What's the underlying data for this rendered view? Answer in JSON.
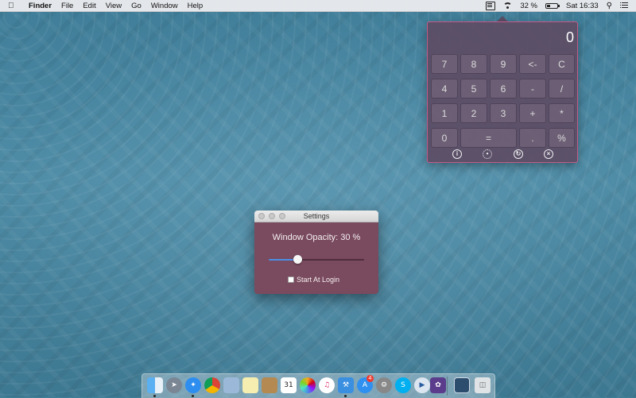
{
  "menubar": {
    "app_name": "Finder",
    "menus": [
      "File",
      "Edit",
      "View",
      "Go",
      "Window",
      "Help"
    ],
    "battery_percent": "32 %",
    "battery_level": 0.32,
    "clock": "Sat 16:33"
  },
  "calculator": {
    "display": "0",
    "keys": {
      "row1": [
        "7",
        "8",
        "9",
        "<-",
        "C"
      ],
      "row2": [
        "4",
        "5",
        "6",
        "-",
        "/"
      ],
      "row3": [
        "1",
        "2",
        "3",
        "+",
        "*"
      ],
      "row4": [
        "0",
        "=",
        ".",
        "%"
      ]
    },
    "toolbar_icons": [
      "info-icon",
      "gear-icon",
      "history-icon",
      "close-icon"
    ]
  },
  "settings": {
    "title": "Settings",
    "opacity_label": "Window Opacity: 30 %",
    "opacity_value": 0.3,
    "start_at_login_label": "Start At Login",
    "start_at_login_checked": false
  },
  "dock": {
    "icons": [
      "finder",
      "launchpad",
      "safari",
      "chrome",
      "preview",
      "notes",
      "contacts",
      "calendar",
      "photos",
      "itunes",
      "xcode",
      "app-store",
      "system-preferences",
      "skype",
      "quicktime",
      "affinity",
      "downloads",
      "trash"
    ],
    "calendar_day": "31",
    "app_store_badge": "4"
  }
}
